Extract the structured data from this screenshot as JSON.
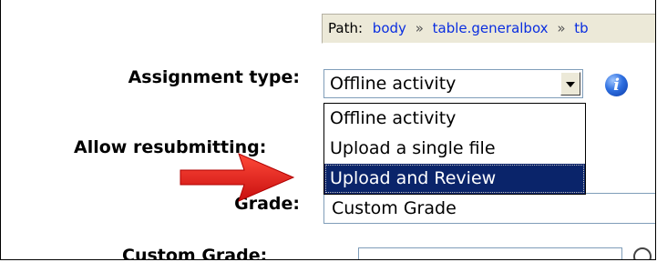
{
  "path": {
    "label": "Path:",
    "segments": [
      "body",
      "table.generalbox",
      "tb"
    ],
    "separator": "»"
  },
  "form": {
    "assignment_type_label": "Assignment type:",
    "assignment_type_value": "Offline activity",
    "allow_resubmitting_label": "Allow resubmitting:",
    "grade_label": "Grade:",
    "grade_value": "Custom Grade",
    "custom_grade_label": "Custom Grade:"
  },
  "dropdown": {
    "options": [
      "Offline activity",
      "Upload a single file",
      "Upload and Review"
    ],
    "selected_index": 2
  },
  "icons": {
    "info": "info-icon",
    "arrow": "red-arrow-annotation"
  },
  "colors": {
    "selection_bg": "#0a246a",
    "link": "#0a2ee0",
    "arrow": "#e02020",
    "info": "#2e6fe0"
  }
}
